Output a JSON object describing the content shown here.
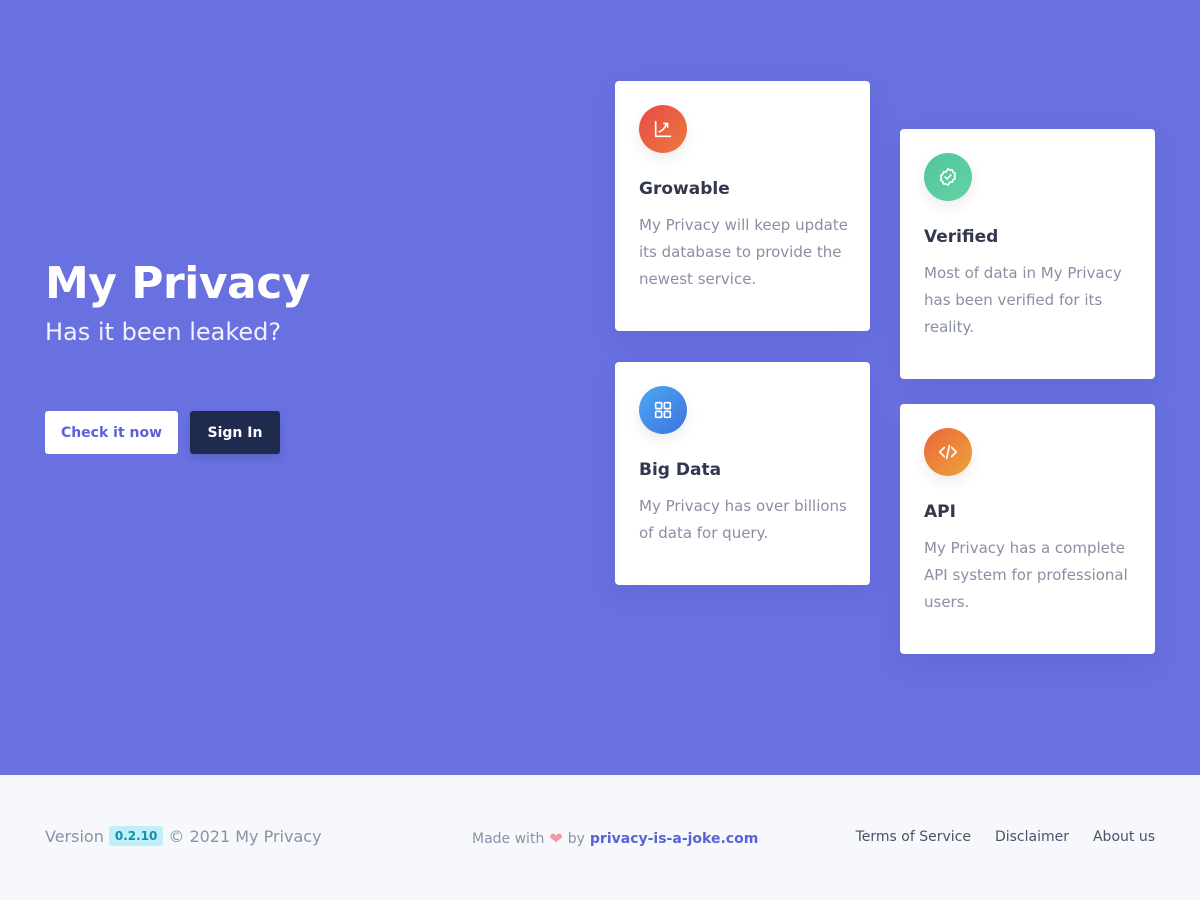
{
  "hero": {
    "title": "My Privacy",
    "subtitle": "Has it been leaked?",
    "primary_button": "Check it now",
    "secondary_button": "Sign In"
  },
  "features": [
    {
      "title": "Growable",
      "text": "My Privacy will keep update its database to provide the newest service.",
      "icon": "chart-up-icon",
      "gradient": [
        "#e94a4a",
        "#ea7a3c"
      ]
    },
    {
      "title": "Verified",
      "text": "Most of data in My Privacy has been verified for its reality.",
      "icon": "verified-badge-icon",
      "gradient": [
        "#52c79a",
        "#61d2a5"
      ]
    },
    {
      "title": "Big Data",
      "text": "My Privacy has over billions of data for query.",
      "icon": "grid-icon",
      "gradient": [
        "#4aa9ef",
        "#3f72e0"
      ]
    },
    {
      "title": "API",
      "text": "My Privacy has a complete API system for professional users.",
      "icon": "code-icon",
      "gradient": [
        "#e9673c",
        "#f0a23a"
      ]
    }
  ],
  "footer": {
    "version_label": "Version",
    "version": "0.2.10",
    "copyright": "© 2021 My Privacy",
    "made_with": "Made with",
    "heart": "❤",
    "by": "by",
    "site": "privacy-is-a-joke.com",
    "links": [
      "Terms of Service",
      "Disclaimer",
      "About us"
    ]
  },
  "colors": {
    "hero_bg": "#6970e0",
    "accent": "#5b62d6",
    "dark_button": "#1f2a4f"
  }
}
